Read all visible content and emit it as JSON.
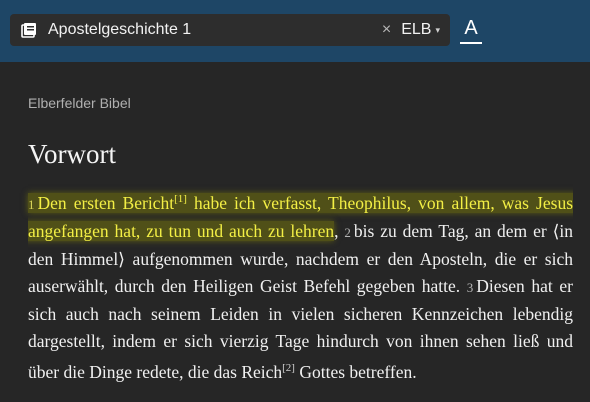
{
  "search": {
    "value": "Apostelgeschichte 1",
    "clear_icon": "×"
  },
  "version": {
    "label": "ELB",
    "caret": "▾"
  },
  "font_button": {
    "label": "A"
  },
  "bible_name": "Elberfelder Bibel",
  "heading": "Vorwort",
  "verses": [
    {
      "num": "1",
      "part1": "Den ersten Bericht",
      "footnote": "[1]",
      "part2": " habe ich verfasst, Theophilus, von allem, was Jesus angefangen hat, zu tun und auch zu lehren",
      "trail": ", "
    },
    {
      "num": "2",
      "text": "bis zu dem Tag, an dem er ⟨in den Himmel⟩ aufgenommen wurde, nachdem er den Aposteln, die er sich auserwählt, durch den Heiligen Geist Befehl gegeben hatte. "
    },
    {
      "num": "3",
      "part1": "Diesen hat er sich auch nach seinem Leiden in vielen sicheren Kennzeichen lebendig dargestellt, indem er sich vierzig Tage hindurch von ihnen sehen ließ und über die Dinge redete, die das Reich",
      "footnote": "[2]",
      "part2": " Gottes betreffen."
    }
  ],
  "colors": {
    "topbar": "#1e4666",
    "highlight_text": "#f3ef45",
    "background": "#262626"
  }
}
